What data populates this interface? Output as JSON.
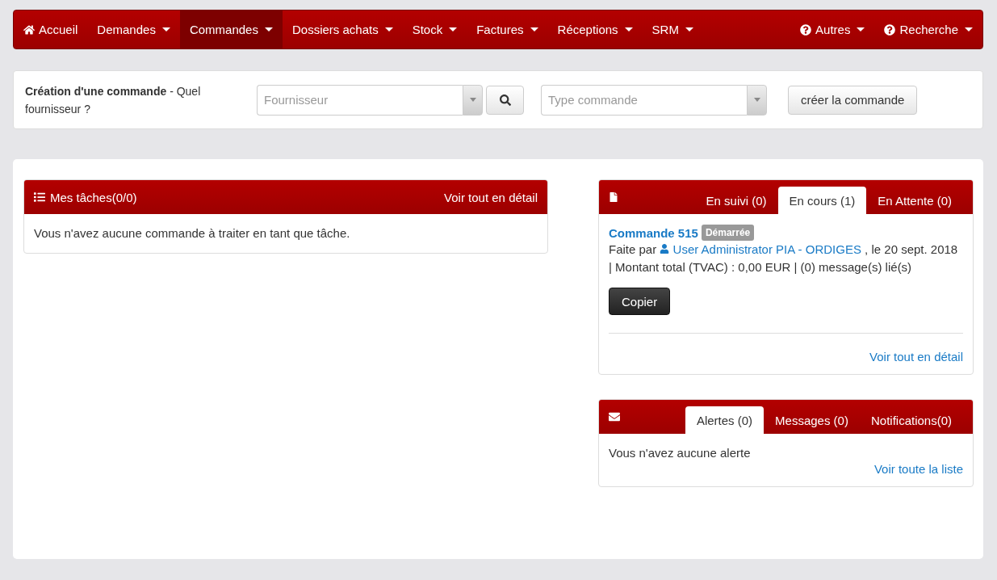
{
  "navbar": {
    "left": [
      {
        "label": "Accueil",
        "kind": "home",
        "caret": false,
        "selected": false
      },
      {
        "label": "Demandes",
        "kind": "plain",
        "caret": true,
        "selected": false
      },
      {
        "label": "Commandes",
        "kind": "plain",
        "caret": true,
        "selected": true
      },
      {
        "label": "Dossiers achats",
        "kind": "plain",
        "caret": true,
        "selected": false
      },
      {
        "label": "Stock",
        "kind": "plain",
        "caret": true,
        "selected": false
      },
      {
        "label": "Factures",
        "kind": "plain",
        "caret": true,
        "selected": false
      },
      {
        "label": "Réceptions",
        "kind": "plain",
        "caret": true,
        "selected": false
      },
      {
        "label": "SRM",
        "kind": "plain",
        "caret": true,
        "selected": false
      }
    ],
    "right": [
      {
        "label": "Autres",
        "kind": "help",
        "caret": true,
        "selected": false
      },
      {
        "label": "Recherche",
        "kind": "help",
        "caret": true,
        "selected": false
      }
    ]
  },
  "order_form": {
    "title": "Création d'une commande",
    "question": " - Quel fournisseur ?",
    "supplier_placeholder": "Fournisseur",
    "type_placeholder": "Type commande",
    "create_button": "créer la commande"
  },
  "tasks": {
    "title": "Mes tâches(0/0)",
    "link": "Voir tout en détail",
    "message": "Vous n'avez aucune commande à traiter en tant que tâche."
  },
  "orders_panel": {
    "tabs": [
      {
        "label": "En suivi (0)",
        "selected": false
      },
      {
        "label": "En cours (1)",
        "selected": true
      },
      {
        "label": "En Attente (0)",
        "selected": false
      }
    ],
    "order": {
      "title": "Commande 515",
      "status": "Démarrée",
      "made_by": "Faite par ",
      "user": "User Administrator PIA - ORDIGES",
      "details": " , le 20 sept. 2018 | Montant total (TVAC) : 0,00 EUR | (0) message(s) lié(s)",
      "copy_button": "Copier"
    },
    "link": "Voir tout en détail"
  },
  "messages_panel": {
    "tabs": [
      {
        "label": "Alertes (0)",
        "selected": true
      },
      {
        "label": "Messages (0)",
        "selected": false
      },
      {
        "label": "Notifications(0)",
        "selected": false
      }
    ],
    "message": "Vous n'avez aucune alerte",
    "link": "Voir toute la liste"
  }
}
